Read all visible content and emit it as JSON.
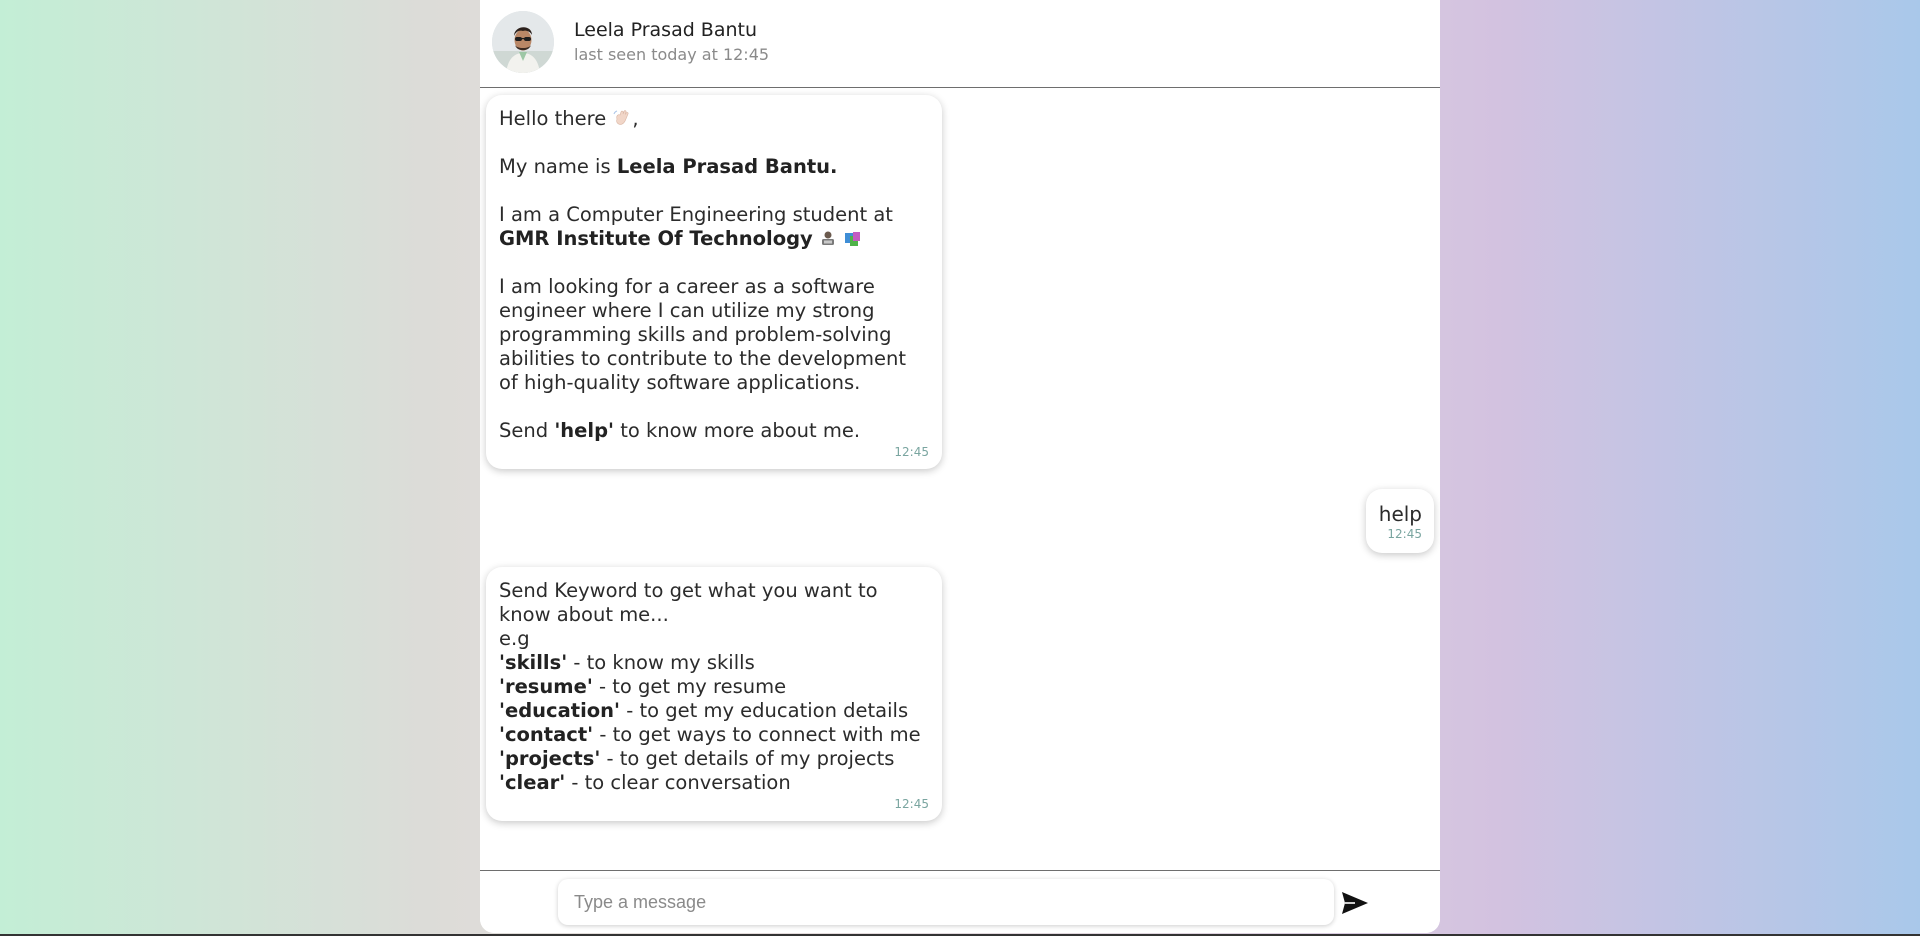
{
  "header": {
    "name": "Leela Prasad Bantu",
    "status": "last seen today at 12:45"
  },
  "messages": {
    "intro": {
      "greeting": "Hello there",
      "greeting_suffix": ",",
      "name_prefix": "My name is ",
      "name_bold": "Leela Prasad Bantu.",
      "student_text": "I am a Computer Engineering student at",
      "college_bold": "GMR Institute Of Technology",
      "career_text": "I am looking for a career as a software engineer where I can utilize my strong programming skills and problem-solving abilities to contribute to the development of high-quality software applications.",
      "send_prefix": "Send ",
      "send_keyword": "'help'",
      "send_suffix": " to know more about me.",
      "time": "12:45"
    },
    "outgoing": {
      "text": "help",
      "time": "12:45"
    },
    "help": {
      "intro_line": "Send Keyword to get what you want to know about me...",
      "eg": "e.g",
      "items": [
        {
          "keyword": "'skills'",
          "desc": " - to know my skills"
        },
        {
          "keyword": "'resume'",
          "desc": " - to get my resume"
        },
        {
          "keyword": "'education'",
          "desc": " - to get my education details"
        },
        {
          "keyword": "'contact'",
          "desc": " - to get ways to connect with me"
        },
        {
          "keyword": "'projects'",
          "desc": " - to get details of my projects"
        },
        {
          "keyword": "'clear'",
          "desc": " - to clear conversation"
        }
      ],
      "time": "12:45"
    }
  },
  "composer": {
    "placeholder": "Type a message",
    "value": ""
  },
  "colors": {
    "timestamp": "#7aa5a0",
    "send_icon": "#111111"
  },
  "icons": {
    "avatar": "avatar-photo",
    "wave": "waving-hand-emoji",
    "student": "technologist-emoji",
    "books": "books-emoji",
    "send": "send-icon"
  }
}
